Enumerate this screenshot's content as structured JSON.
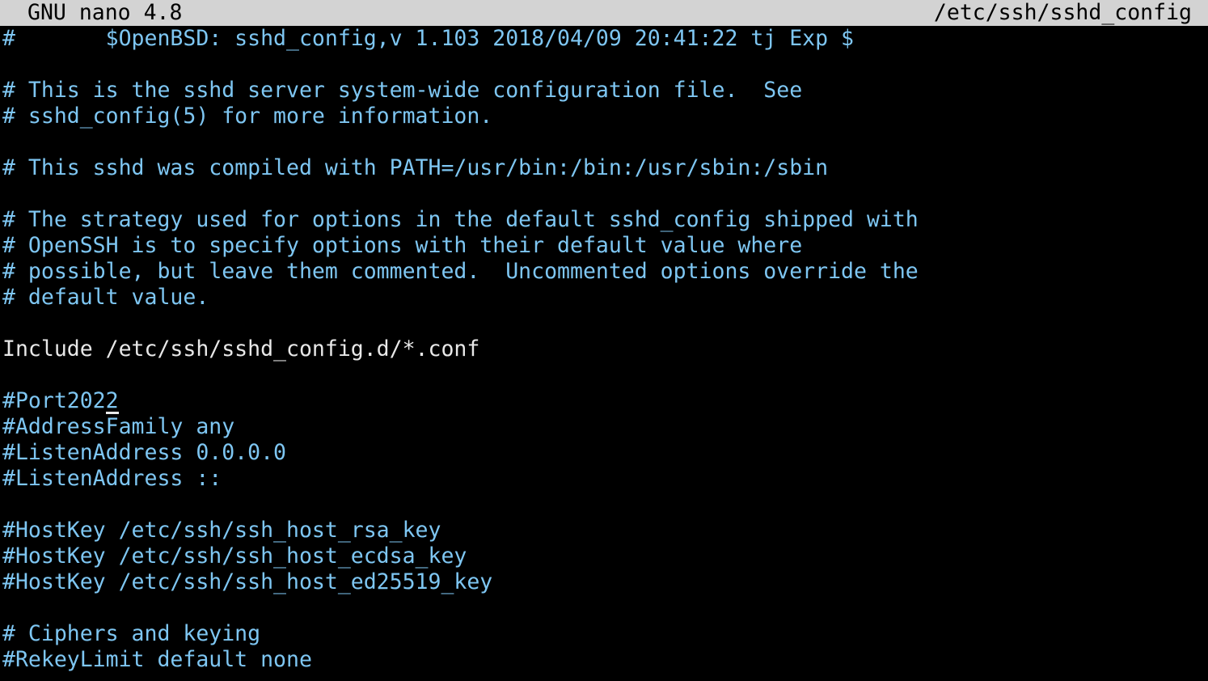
{
  "titlebar": {
    "app_name": "GNU nano 4.8",
    "file_path": "/etc/ssh/sshd_config"
  },
  "colors": {
    "comment": "#7ec6f2",
    "plain": "#e8e8e8",
    "titlebar_bg": "#d3d3d3",
    "background": "#000000"
  },
  "cursor": {
    "line": 16,
    "column": 8
  },
  "lines": [
    {
      "text": "#\t$OpenBSD: sshd_config,v 1.103 2018/04/09 20:41:22 tj Exp $",
      "kind": "comment"
    },
    {
      "text": "",
      "kind": "plain"
    },
    {
      "text": "# This is the sshd server system-wide configuration file.  See",
      "kind": "comment"
    },
    {
      "text": "# sshd_config(5) for more information.",
      "kind": "comment"
    },
    {
      "text": "",
      "kind": "plain"
    },
    {
      "text": "# This sshd was compiled with PATH=/usr/bin:/bin:/usr/sbin:/sbin",
      "kind": "comment"
    },
    {
      "text": "",
      "kind": "plain"
    },
    {
      "text": "# The strategy used for options in the default sshd_config shipped with",
      "kind": "comment"
    },
    {
      "text": "# OpenSSH is to specify options with their default value where",
      "kind": "comment"
    },
    {
      "text": "# possible, but leave them commented.  Uncommented options override the",
      "kind": "comment"
    },
    {
      "text": "# default value.",
      "kind": "comment"
    },
    {
      "text": "",
      "kind": "plain"
    },
    {
      "text": "Include /etc/ssh/sshd_config.d/*.conf",
      "kind": "plain"
    },
    {
      "text": "",
      "kind": "plain"
    },
    {
      "text": "#Port2022",
      "kind": "comment"
    },
    {
      "text": "#AddressFamily any",
      "kind": "comment"
    },
    {
      "text": "#ListenAddress 0.0.0.0",
      "kind": "comment"
    },
    {
      "text": "#ListenAddress ::",
      "kind": "comment"
    },
    {
      "text": "",
      "kind": "plain"
    },
    {
      "text": "#HostKey /etc/ssh/ssh_host_rsa_key",
      "kind": "comment"
    },
    {
      "text": "#HostKey /etc/ssh/ssh_host_ecdsa_key",
      "kind": "comment"
    },
    {
      "text": "#HostKey /etc/ssh/ssh_host_ed25519_key",
      "kind": "comment"
    },
    {
      "text": "",
      "kind": "plain"
    },
    {
      "text": "# Ciphers and keying",
      "kind": "comment"
    },
    {
      "text": "#RekeyLimit default none",
      "kind": "comment"
    }
  ]
}
